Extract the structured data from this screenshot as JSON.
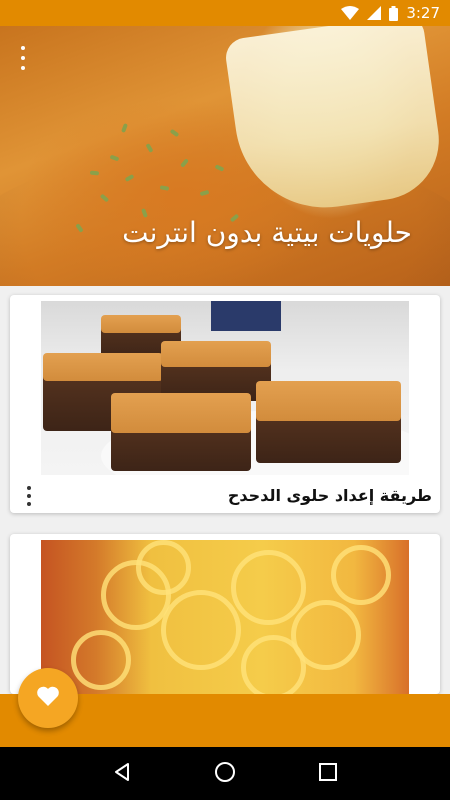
{
  "status_bar": {
    "time": "3:27",
    "icons": [
      "wifi-icon",
      "signal-icon",
      "battery-icon"
    ]
  },
  "header": {
    "title": "حلويات بيتية بدون انترنت",
    "menu_icon": "overflow-menu-icon"
  },
  "recipes": [
    {
      "title": "طريقة إعداد حلوى الدحدح",
      "image": "basbousa-squares-photo",
      "menu_icon": "overflow-menu-icon"
    },
    {
      "title": "",
      "image": "jalebi-sweets-photo",
      "menu_icon": "overflow-menu-icon"
    }
  ],
  "fab": {
    "icon": "heart-icon"
  },
  "nav": {
    "back_icon": "back-icon",
    "home_icon": "home-icon",
    "recents_icon": "recents-icon"
  },
  "colors": {
    "accent": "#e28a00",
    "fab": "#f5a623",
    "nav": "#000000"
  }
}
